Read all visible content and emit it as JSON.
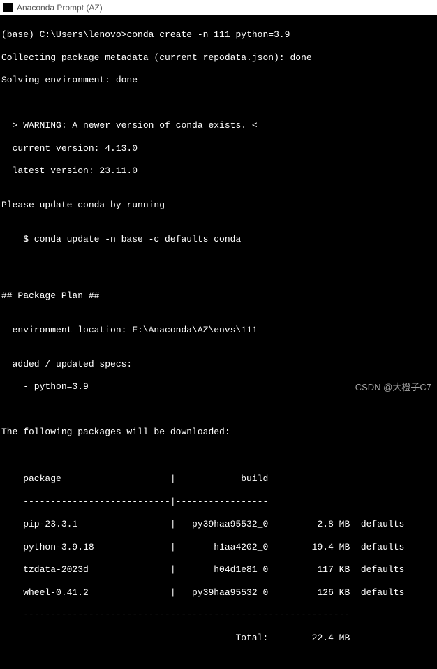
{
  "window": {
    "title": "Anaconda Prompt (AZ)"
  },
  "prompt": {
    "cwd": "(base) C:\\Users\\lenovo>",
    "command": "conda create -n 111 python=3.9"
  },
  "lines": {
    "collecting": "Collecting package metadata (current_repodata.json): done",
    "solving": "Solving environment: done",
    "blank": "",
    "warn_header": "==> WARNING: A newer version of conda exists. <==",
    "warn_curr": "  current version: 4.13.0",
    "warn_latest": "  latest version: 23.11.0",
    "please_update": "Please update conda by running",
    "update_cmd": "    $ conda update -n base -c defaults conda",
    "plan_header": "## Package Plan ##",
    "env_loc": "  environment location: F:\\Anaconda\\AZ\\envs\\111",
    "added_specs": "  added / updated specs:",
    "spec_python": "    - python=3.9",
    "dl_header": "The following packages will be downloaded:",
    "col_header": "    package                    |            build",
    "col_rule": "    ---------------------------|-----------------",
    "row_pip": "    pip-23.3.1                 |   py39haa95532_0         2.8 MB  defaults",
    "row_python": "    python-3.9.18              |       h1aa4202_0        19.4 MB  defaults",
    "row_tzdata": "    tzdata-2023d               |       h04d1e81_0         117 KB  defaults",
    "row_wheel": "    wheel-0.41.2               |   py39haa95532_0         126 KB  defaults",
    "final_rule": "    ------------------------------------------------------------",
    "total": "                                           Total:        22.4 MB"
  },
  "watermark": "CSDN @大橙子C7"
}
